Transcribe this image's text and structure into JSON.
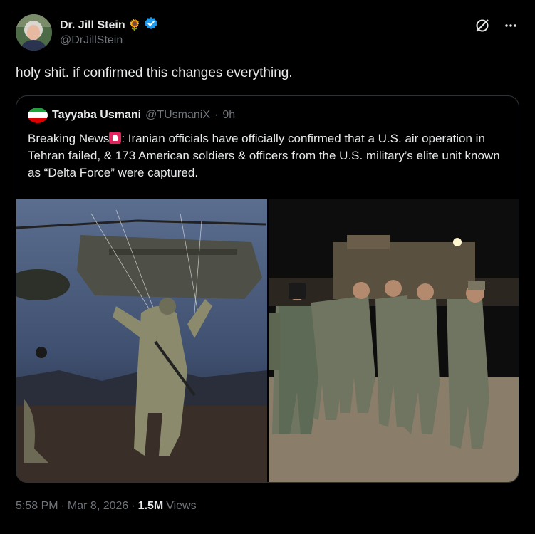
{
  "author": {
    "display_name": "Dr. Jill Stein",
    "emoji": "🌻",
    "handle": "@DrJillStein"
  },
  "tweet": {
    "text": "holy shit. if confirmed this changes everything."
  },
  "quoted": {
    "display_name": "Tayyaba Usmani",
    "handle": "@TUsmaniX",
    "separator": "·",
    "time_ago": "9h",
    "text_prefix": "Breaking News",
    "text_body": ": Iranian officials have officially confirmed that a U.S. air operation in Tehran failed, & 173 American soldiers & officers from the U.S. military’s elite unit known as “Delta Force” were captured."
  },
  "footer": {
    "time": "5:58 PM",
    "sep1": "·",
    "date": "Mar 8, 2026",
    "sep2": "·",
    "views_count": "1.5M",
    "views_label": "Views"
  },
  "colors": {
    "background": "#000000",
    "text_primary": "#e7e9ea",
    "text_secondary": "#71767b",
    "border": "#2f3336",
    "verified": "#1d9bf0"
  },
  "icons": {
    "verified": "verified-badge-icon",
    "grok": "grok-icon",
    "more": "more-icon"
  }
}
